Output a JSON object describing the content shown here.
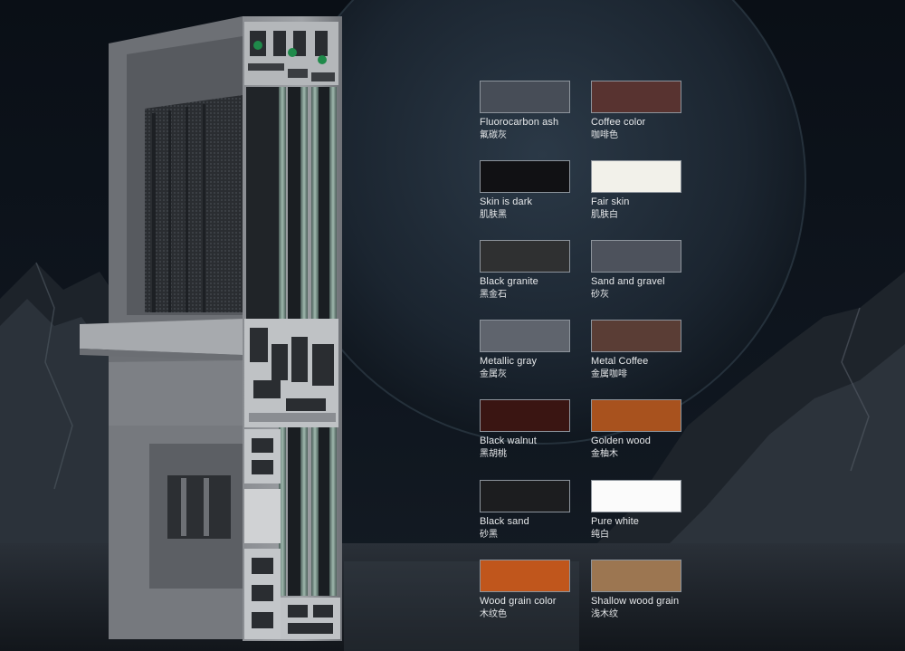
{
  "swatches": [
    {
      "name_en": "Fluorocarbon ash",
      "name_zh": "氟碳灰",
      "color": "#474d57"
    },
    {
      "name_en": "Coffee color",
      "name_zh": "咖啡色",
      "color": "#583330"
    },
    {
      "name_en": "Skin is dark",
      "name_zh": "肌肤黑",
      "color": "#111114"
    },
    {
      "name_en": "Fair skin",
      "name_zh": "肌肤白",
      "color": "#f2f1ea"
    },
    {
      "name_en": "Black granite",
      "name_zh": "黑金石",
      "color": "#2f3031"
    },
    {
      "name_en": "Sand and gravel",
      "name_zh": "砂灰",
      "color": "#4d525c"
    },
    {
      "name_en": "Metallic gray",
      "name_zh": "金属灰",
      "color": "#5f646d"
    },
    {
      "name_en": "Metal Coffee",
      "name_zh": "金属咖啡",
      "color": "#5a3d35"
    },
    {
      "name_en": "Black walnut",
      "name_zh": "黑胡桃",
      "color": "#3a1512"
    },
    {
      "name_en": "Golden wood",
      "name_zh": "金柚木",
      "color": "#a8521e"
    },
    {
      "name_en": "Black sand",
      "name_zh": "砂黑",
      "color": "#1c1d1f"
    },
    {
      "name_en": "Pure white",
      "name_zh": "纯白",
      "color": "#fbfbfb"
    },
    {
      "name_en": "Wood grain color",
      "name_zh": "木纹色",
      "color": "#c0561c"
    },
    {
      "name_en": "Shallow wood grain",
      "name_zh": "浅木纹",
      "color": "#9c7651"
    }
  ]
}
